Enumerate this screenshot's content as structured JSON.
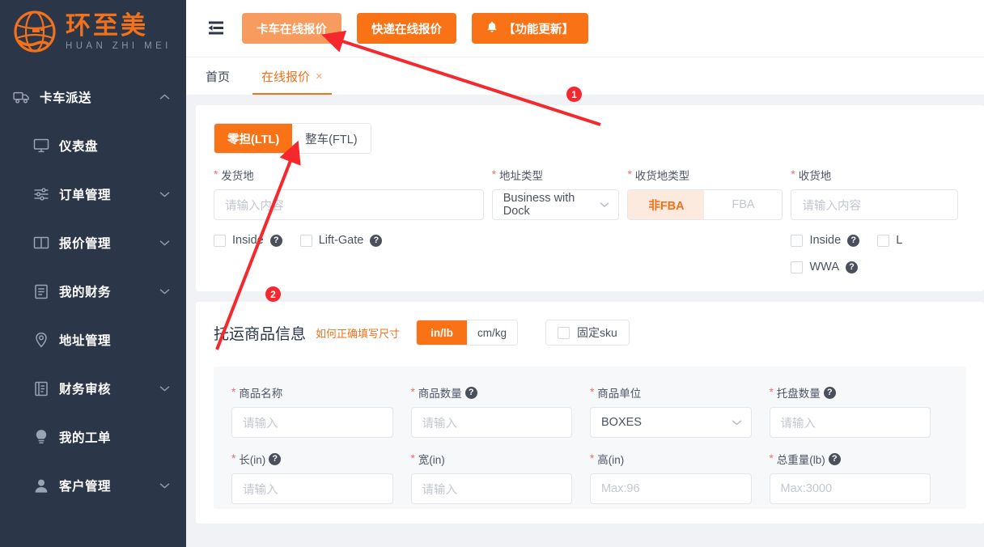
{
  "brand": {
    "name_cn": "环至美",
    "name_en": "HUAN ZHI MEI",
    "logo_icon": "globe-hand-logo"
  },
  "sidebar": {
    "items": [
      {
        "label": "卡车派送",
        "icon": "truck-icon",
        "level": "top",
        "chevron": "chevron-up",
        "expanded": true
      },
      {
        "label": "仪表盘",
        "icon": "monitor-icon",
        "level": "sub",
        "chevron": ""
      },
      {
        "label": "订单管理",
        "icon": "sliders-icon",
        "level": "sub",
        "chevron": "chevron-down"
      },
      {
        "label": "报价管理",
        "icon": "book-icon",
        "level": "sub",
        "chevron": "chevron-down"
      },
      {
        "label": "我的财务",
        "icon": "document-icon",
        "level": "sub",
        "chevron": "chevron-down"
      },
      {
        "label": "地址管理",
        "icon": "map-pin-icon",
        "level": "sub",
        "chevron": ""
      },
      {
        "label": "财务审核",
        "icon": "ledger-icon",
        "level": "sub",
        "chevron": "chevron-down"
      },
      {
        "label": "我的工单",
        "icon": "lightbulb-icon",
        "level": "sub",
        "chevron": ""
      },
      {
        "label": "客户管理",
        "icon": "user-icon",
        "level": "sub",
        "chevron": "chevron-down"
      }
    ]
  },
  "topbar": {
    "collapse_icon": "menu-collapse-icon",
    "buttons": [
      {
        "label": "卡车在线报价",
        "style": "soft",
        "icon": ""
      },
      {
        "label": "快递在线报价",
        "style": "solid",
        "icon": ""
      },
      {
        "label": "【功能更新】",
        "style": "solid",
        "icon": "bell-icon"
      }
    ]
  },
  "tabs": [
    {
      "label": "首页",
      "active": false,
      "closable": false
    },
    {
      "label": "在线报价",
      "active": true,
      "closable": true,
      "close_glyph": "×"
    }
  ],
  "shipment": {
    "mode_tabs": [
      {
        "label": "零担(LTL)",
        "active": true
      },
      {
        "label": "整车(FTL)",
        "active": false
      }
    ],
    "origin": {
      "label": "发货地",
      "required": true,
      "placeholder": "请输入内容",
      "value": ""
    },
    "address_type": {
      "label": "地址类型",
      "required": true,
      "value": "Business with Dock",
      "caret": "chevron-down"
    },
    "dest_type": {
      "label": "收货地类型",
      "required": true,
      "options": [
        {
          "label": "非FBA",
          "active": true
        },
        {
          "label": "FBA",
          "active": false
        }
      ]
    },
    "destination": {
      "label": "收货地",
      "required": true,
      "placeholder": "请输入内容",
      "value": ""
    },
    "origin_options": [
      {
        "label": "Inside",
        "checked": false,
        "help": "?"
      },
      {
        "label": "Lift-Gate",
        "checked": false,
        "help": "?"
      }
    ],
    "dest_options_row1": [
      {
        "label": "Inside",
        "checked": false,
        "help": "?"
      },
      {
        "label": "L",
        "checked": false,
        "help": ""
      }
    ],
    "dest_options_row2": [
      {
        "label": "WWA",
        "checked": false,
        "help": "?"
      }
    ]
  },
  "goods": {
    "title": "托运商品信息",
    "hint": "如何正确填写尺寸",
    "unit_options": [
      {
        "label": "in/lb",
        "active": true
      },
      {
        "label": "cm/kg",
        "active": false
      }
    ],
    "fixed_sku": {
      "label": "固定sku",
      "checked": false
    },
    "row1": [
      {
        "label": "商品名称",
        "required": true,
        "type": "input",
        "placeholder": "请输入",
        "value": "",
        "help": false
      },
      {
        "label": "商品数量",
        "required": true,
        "type": "input",
        "placeholder": "请输入",
        "value": "",
        "help": true
      },
      {
        "label": "商品单位",
        "required": true,
        "type": "select",
        "value": "BOXES",
        "help": false
      },
      {
        "label": "托盘数量",
        "required": true,
        "type": "input",
        "placeholder": "请输入",
        "value": "",
        "help": true
      }
    ],
    "row2": [
      {
        "label": "长(in)",
        "required": true,
        "type": "input",
        "placeholder": "请输入",
        "value": "",
        "help": true
      },
      {
        "label": "宽(in)",
        "required": true,
        "type": "input",
        "placeholder": "请输入",
        "value": "",
        "help": false
      },
      {
        "label": "高(in)",
        "required": true,
        "type": "input",
        "placeholder": "Max:96",
        "value": "",
        "help": false
      },
      {
        "label": "总重量(lb)",
        "required": true,
        "type": "input",
        "placeholder": "Max:3000",
        "value": "",
        "help": true
      }
    ]
  },
  "annotations": [
    {
      "number": "1",
      "color": "#f4282d"
    },
    {
      "number": "2",
      "color": "#f4282d"
    }
  ],
  "colors": {
    "brand_orange": "#f2711c",
    "button_orange": "#f97316",
    "sidebar_bg": "#2b3648",
    "annotation_red": "#f4282d",
    "page_bg": "#f0f2f5"
  }
}
